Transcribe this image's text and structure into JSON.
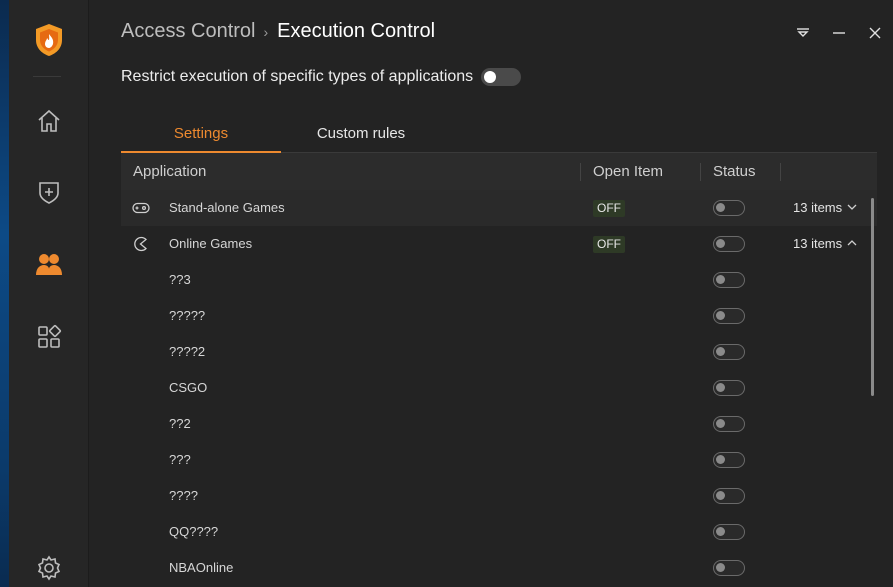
{
  "breadcrumb": {
    "parent": "Access Control",
    "separator": "›",
    "current": "Execution Control"
  },
  "window_controls": {
    "menu": "⩡",
    "minimize": "—",
    "close": "✕"
  },
  "restrict": {
    "label": "Restrict execution of specific types of applications",
    "enabled": false
  },
  "tabs": [
    {
      "label": "Settings",
      "active": true
    },
    {
      "label": "Custom rules",
      "active": false
    }
  ],
  "table": {
    "headers": {
      "application": "Application",
      "open_item": "Open Item",
      "status": "Status"
    },
    "rows": [
      {
        "name": "Stand-alone Games",
        "icon": "gamepad-icon",
        "open_item": "OFF",
        "count": "13 items",
        "expanded": false,
        "status": false
      },
      {
        "name": "Online Games",
        "icon": "pacman-icon",
        "open_item": "OFF",
        "count": "13 items",
        "expanded": true,
        "status": false
      },
      {
        "name": "??3",
        "status": false
      },
      {
        "name": "?????",
        "status": false
      },
      {
        "name": "????2",
        "status": false
      },
      {
        "name": "CSGO",
        "status": false
      },
      {
        "name": "??2",
        "status": false
      },
      {
        "name": "???",
        "status": false
      },
      {
        "name": "????",
        "status": false
      },
      {
        "name": "QQ????",
        "status": false
      },
      {
        "name": "NBAOnline",
        "status": false
      }
    ]
  },
  "sidebar": {
    "items": [
      {
        "name": "logo-icon"
      },
      {
        "name": "home-icon"
      },
      {
        "name": "shield-plus-icon"
      },
      {
        "name": "users-icon",
        "active": true
      },
      {
        "name": "apps-icon"
      },
      {
        "name": "settings-gear-icon"
      }
    ]
  },
  "colors": {
    "accent": "#ee8a2f",
    "background": "#232323",
    "sidebar": "#262626"
  }
}
